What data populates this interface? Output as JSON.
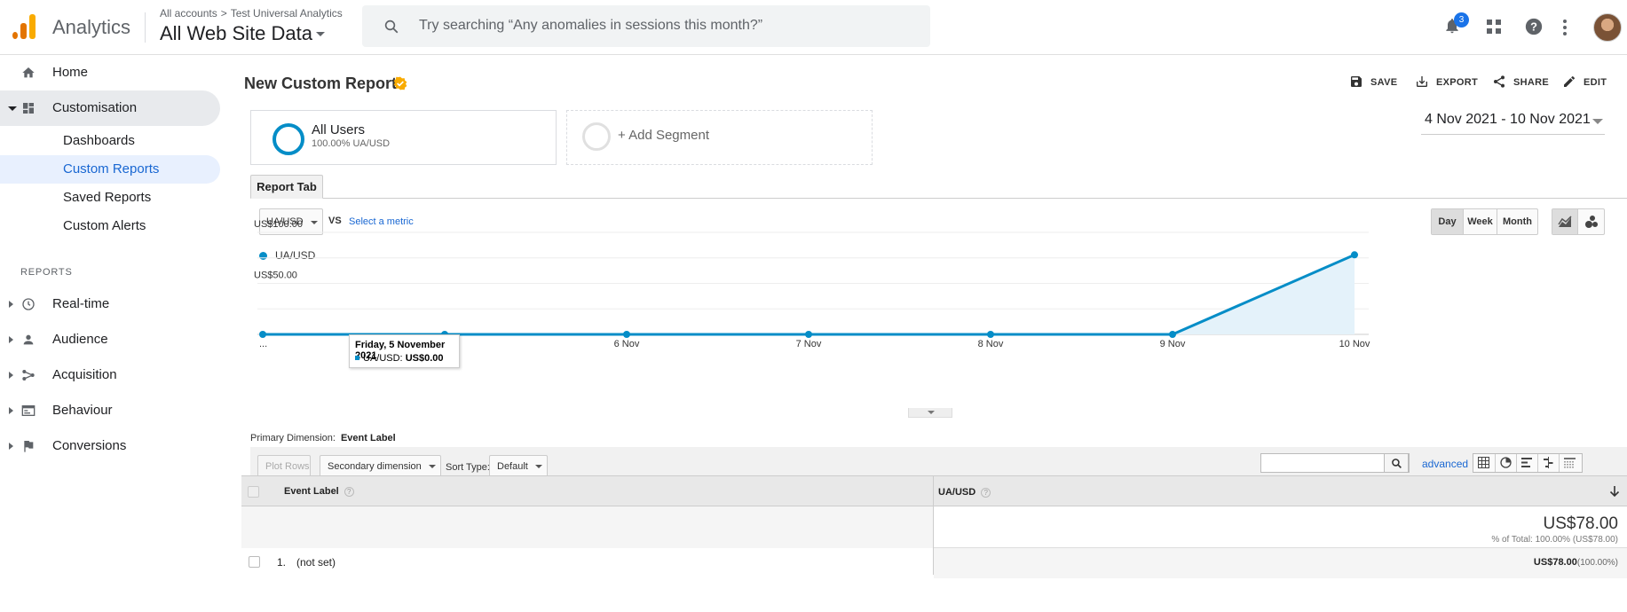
{
  "topbar": {
    "app_name": "Analytics",
    "breadcrumb": [
      "All accounts",
      "Test Universal Analytics"
    ],
    "breadcrumb_sep": ">",
    "view_name": "All Web Site Data",
    "search_placeholder": "Try searching “Any anomalies in sessions this month?”",
    "notification_count": "3"
  },
  "sidebar": {
    "home": "Home",
    "customisation": "Customisation",
    "sub_items": [
      "Dashboards",
      "Custom Reports",
      "Saved Reports",
      "Custom Alerts"
    ],
    "reports_header": "REPORTS",
    "report_items": [
      "Real-time",
      "Audience",
      "Acquisition",
      "Behaviour",
      "Conversions"
    ]
  },
  "report": {
    "title": "New Custom Report",
    "actions": {
      "save": "SAVE",
      "export": "EXPORT",
      "share": "SHARE",
      "edit": "EDIT"
    },
    "segment_name": "All Users",
    "segment_sub": "100.00% UA/USD",
    "add_segment": "+ Add Segment",
    "date_range": "4 Nov 2021 - 10 Nov 2021",
    "tab": "Report Tab",
    "metric": "UA/USD",
    "vs": "VS",
    "select_metric": "Select a metric",
    "granularity": {
      "day": "Day",
      "week": "Week",
      "month": "Month"
    }
  },
  "chart_data": {
    "type": "area",
    "series": [
      {
        "name": "UA/USD",
        "values": [
          0,
          0,
          0,
          0,
          0,
          0,
          78
        ]
      }
    ],
    "categories": [
      "4 Nov",
      "5 Nov",
      "6 Nov",
      "7 Nov",
      "8 Nov",
      "9 Nov",
      "10 Nov"
    ],
    "x_tick_labels": [
      "...",
      "5 Nov",
      "6 Nov",
      "7 Nov",
      "8 Nov",
      "9 Nov",
      "10 Nov"
    ],
    "y_tick_labels": [
      "US$100.00",
      "US$50.00"
    ],
    "ylim": [
      0,
      100
    ],
    "color": "#058dc7",
    "tooltip": {
      "title": "Friday, 5 November 2021",
      "series": "UA/USD:",
      "value": "US$0.00"
    }
  },
  "table": {
    "primary_dimension_label": "Primary Dimension:",
    "primary_dimension": "Event Label",
    "plot_rows": "Plot Rows",
    "secondary_dimension": "Secondary dimension",
    "sort_type_label": "Sort Type:",
    "sort_type": "Default",
    "advanced": "advanced",
    "col_dimension": "Event Label",
    "col_metric": "UA/USD",
    "total_value": "US$78.00",
    "total_sub": "% of Total: 100.00% (US$78.00)",
    "rows": [
      {
        "num": "1.",
        "label": "(not set)",
        "value": "US$78.00",
        "pct": "(100.00%)"
      }
    ]
  }
}
